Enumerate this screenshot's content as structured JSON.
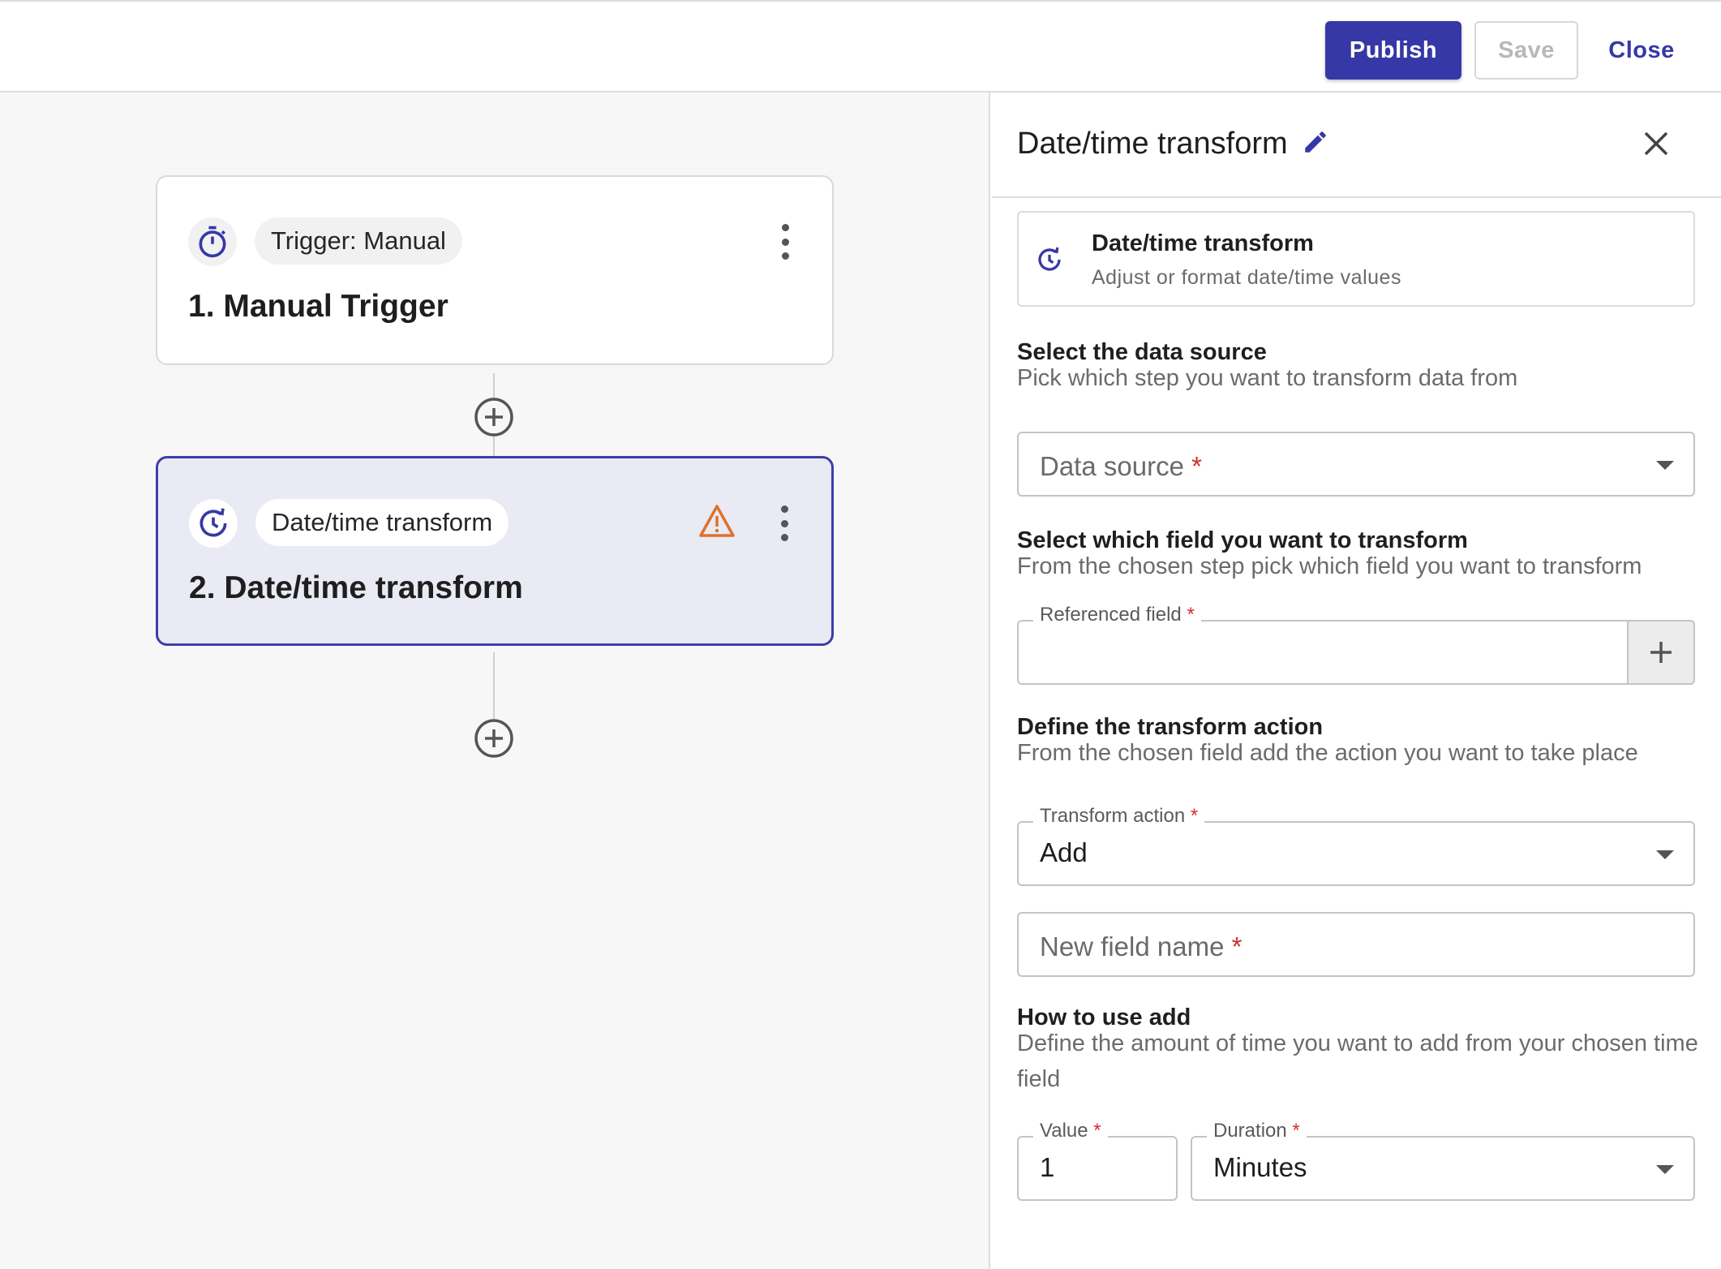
{
  "toolbar": {
    "publish_label": "Publish",
    "save_label": "Save",
    "close_label": "Close"
  },
  "flow": {
    "steps": [
      {
        "chip": "Trigger: Manual",
        "title": "1. Manual Trigger",
        "icon": "timer-icon"
      },
      {
        "chip": "Date/time transform",
        "title": "2. Date/time transform",
        "icon": "clock-refresh-icon",
        "warning_icon": "warning-icon"
      }
    ]
  },
  "panel": {
    "title": "Date/time transform",
    "info": {
      "title": "Date/time transform",
      "subtitle": "Adjust or format date/time values"
    },
    "data_source": {
      "heading": "Select the data source",
      "description": "Pick which step you want to transform data from",
      "placeholder": "Data source"
    },
    "field": {
      "heading": "Select which field you want to transform",
      "description": "From the chosen step pick which field you want to transform",
      "label": "Referenced field"
    },
    "action": {
      "heading": "Define the transform action",
      "description": "From the chosen field add the action you want to take place",
      "label": "Transform action",
      "value": "Add"
    },
    "new_field": {
      "placeholder": "New field name"
    },
    "how_to": {
      "heading": "How to use add",
      "description": "Define the amount of time you want to add from your chosen time field"
    },
    "value_field": {
      "label": "Value",
      "value": "1"
    },
    "duration_field": {
      "label": "Duration",
      "value": "Minutes"
    },
    "required_mark": "*"
  },
  "colors": {
    "accent": "#3638a7",
    "warning": "#e0702a",
    "required": "#d32f2f"
  }
}
